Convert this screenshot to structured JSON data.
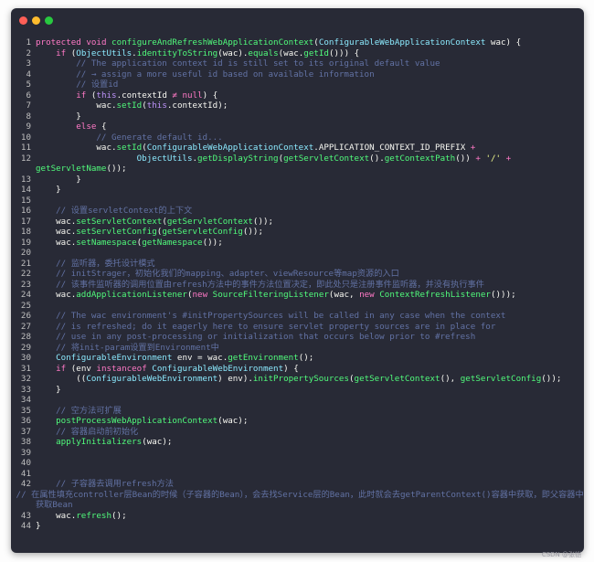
{
  "window": {
    "traffic_lights": {
      "close_color": "#ff5f57",
      "minimize_color": "#febc2e",
      "zoom_color": "#28c840"
    }
  },
  "code_lines": [
    {
      "n": "1",
      "t": [
        [
          "kw",
          "protected"
        ],
        [
          "id",
          " "
        ],
        [
          "kw",
          "void"
        ],
        [
          "id",
          " "
        ],
        [
          "fn",
          "configureAndRefreshWebApplicationContext"
        ],
        [
          "id",
          "("
        ],
        [
          "ty",
          "ConfigurableWebApplicationContext"
        ],
        [
          "id",
          " wac) {"
        ]
      ]
    },
    {
      "n": "2",
      "t": [
        [
          "id",
          "    "
        ],
        [
          "kw",
          "if"
        ],
        [
          "id",
          " ("
        ],
        [
          "ty",
          "ObjectUtils"
        ],
        [
          "id",
          "."
        ],
        [
          "fn",
          "identityToString"
        ],
        [
          "id",
          "(wac)."
        ],
        [
          "fn",
          "equals"
        ],
        [
          "id",
          "(wac."
        ],
        [
          "fn",
          "getId"
        ],
        [
          "id",
          "())) {"
        ]
      ]
    },
    {
      "n": "3",
      "t": [
        [
          "id",
          "        "
        ],
        [
          "cm",
          "// The application context id is still set to its original default value"
        ]
      ]
    },
    {
      "n": "4",
      "t": [
        [
          "id",
          "        "
        ],
        [
          "cm",
          "// → assign a more useful id based on available information"
        ]
      ]
    },
    {
      "n": "5",
      "t": [
        [
          "id",
          "        "
        ],
        [
          "cm",
          "// 设置id"
        ]
      ]
    },
    {
      "n": "6",
      "t": [
        [
          "id",
          "        "
        ],
        [
          "kw",
          "if"
        ],
        [
          "id",
          " ("
        ],
        [
          "th",
          "this"
        ],
        [
          "id",
          ".contextId "
        ],
        [
          "op",
          "≠"
        ],
        [
          "id",
          " "
        ],
        [
          "kw",
          "null"
        ],
        [
          "id",
          ") {"
        ]
      ]
    },
    {
      "n": "7",
      "t": [
        [
          "id",
          "            wac."
        ],
        [
          "fn",
          "setId"
        ],
        [
          "id",
          "("
        ],
        [
          "th",
          "this"
        ],
        [
          "id",
          ".contextId);"
        ]
      ]
    },
    {
      "n": "8",
      "t": [
        [
          "id",
          "        }"
        ]
      ]
    },
    {
      "n": "9",
      "t": [
        [
          "id",
          "        "
        ],
        [
          "kw",
          "else"
        ],
        [
          "id",
          " {"
        ]
      ]
    },
    {
      "n": "10",
      "t": [
        [
          "id",
          "            "
        ],
        [
          "cm",
          "// Generate default id..."
        ]
      ]
    },
    {
      "n": "11",
      "t": [
        [
          "id",
          "            wac."
        ],
        [
          "fn",
          "setId"
        ],
        [
          "id",
          "("
        ],
        [
          "ty",
          "ConfigurableWebApplicationContext"
        ],
        [
          "id",
          ".APPLICATION_CONTEXT_ID_PREFIX "
        ],
        [
          "op",
          "+"
        ]
      ]
    },
    {
      "n": "12",
      "t": [
        [
          "id",
          "                    "
        ],
        [
          "ty",
          "ObjectUtils"
        ],
        [
          "id",
          "."
        ],
        [
          "fn",
          "getDisplayString"
        ],
        [
          "id",
          "("
        ],
        [
          "fn",
          "getServletContext"
        ],
        [
          "id",
          "()."
        ],
        [
          "fn",
          "getContextPath"
        ],
        [
          "id",
          "()) "
        ],
        [
          "op",
          "+"
        ],
        [
          "id",
          " "
        ],
        [
          "st",
          "'/'"
        ],
        [
          "id",
          " "
        ],
        [
          "op",
          "+"
        ]
      ]
    },
    {
      "n": "",
      "t": [
        [
          "fn",
          "getServletName"
        ],
        [
          "id",
          "());"
        ]
      ]
    },
    {
      "n": "13",
      "t": [
        [
          "id",
          "        }"
        ]
      ]
    },
    {
      "n": "14",
      "t": [
        [
          "id",
          "    }"
        ]
      ]
    },
    {
      "n": "15",
      "t": [
        [
          "id",
          ""
        ]
      ]
    },
    {
      "n": "16",
      "t": [
        [
          "id",
          "    "
        ],
        [
          "cm",
          "// 设置servletContext的上下文"
        ]
      ]
    },
    {
      "n": "17",
      "t": [
        [
          "id",
          "    wac."
        ],
        [
          "fn",
          "setServletContext"
        ],
        [
          "id",
          "("
        ],
        [
          "fn",
          "getServletContext"
        ],
        [
          "id",
          "());"
        ]
      ]
    },
    {
      "n": "18",
      "t": [
        [
          "id",
          "    wac."
        ],
        [
          "fn",
          "setServletConfig"
        ],
        [
          "id",
          "("
        ],
        [
          "fn",
          "getServletConfig"
        ],
        [
          "id",
          "());"
        ]
      ]
    },
    {
      "n": "19",
      "t": [
        [
          "id",
          "    wac."
        ],
        [
          "fn",
          "setNamespace"
        ],
        [
          "id",
          "("
        ],
        [
          "fn",
          "getNamespace"
        ],
        [
          "id",
          "());"
        ]
      ]
    },
    {
      "n": "20",
      "t": [
        [
          "id",
          ""
        ]
      ]
    },
    {
      "n": "21",
      "t": [
        [
          "id",
          "    "
        ],
        [
          "cm",
          "// 监听器，委托设计模式"
        ]
      ]
    },
    {
      "n": "22",
      "t": [
        [
          "id",
          "    "
        ],
        [
          "cm",
          "// initStrager，初始化我们的mapping、adapter、viewResource等map资源的入口"
        ]
      ]
    },
    {
      "n": "23",
      "t": [
        [
          "id",
          "    "
        ],
        [
          "cm",
          "// 该事件监听器的调用位置由refresh方法中的事件方法位置决定，即此处只是注册事件监听器，并没有执行事件"
        ]
      ]
    },
    {
      "n": "24",
      "t": [
        [
          "id",
          "    wac."
        ],
        [
          "fn",
          "addApplicationListener"
        ],
        [
          "id",
          "("
        ],
        [
          "kw",
          "new"
        ],
        [
          "id",
          " "
        ],
        [
          "fn",
          "SourceFilteringListener"
        ],
        [
          "id",
          "(wac, "
        ],
        [
          "kw",
          "new"
        ],
        [
          "id",
          " "
        ],
        [
          "fn",
          "ContextRefreshListener"
        ],
        [
          "id",
          "()));"
        ]
      ]
    },
    {
      "n": "25",
      "t": [
        [
          "id",
          ""
        ]
      ]
    },
    {
      "n": "26",
      "t": [
        [
          "id",
          "    "
        ],
        [
          "cm",
          "// The wac environment's #initPropertySources will be called in any case when the context"
        ]
      ]
    },
    {
      "n": "27",
      "t": [
        [
          "id",
          "    "
        ],
        [
          "cm",
          "// is refreshed; do it eagerly here to ensure servlet property sources are in place for"
        ]
      ]
    },
    {
      "n": "28",
      "t": [
        [
          "id",
          "    "
        ],
        [
          "cm",
          "// use in any post-processing or initialization that occurs below prior to #refresh"
        ]
      ]
    },
    {
      "n": "29",
      "t": [
        [
          "id",
          "    "
        ],
        [
          "cm",
          "// 将init-param设置到Environment中"
        ]
      ]
    },
    {
      "n": "30",
      "t": [
        [
          "id",
          "    "
        ],
        [
          "ty",
          "ConfigurableEnvironment"
        ],
        [
          "id",
          " env = wac."
        ],
        [
          "fn",
          "getEnvironment"
        ],
        [
          "id",
          "();"
        ]
      ]
    },
    {
      "n": "31",
      "t": [
        [
          "id",
          "    "
        ],
        [
          "kw",
          "if"
        ],
        [
          "id",
          " (env "
        ],
        [
          "kw",
          "instanceof"
        ],
        [
          "id",
          " "
        ],
        [
          "ty",
          "ConfigurableWebEnvironment"
        ],
        [
          "id",
          ") {"
        ]
      ]
    },
    {
      "n": "32",
      "t": [
        [
          "id",
          "        (("
        ],
        [
          "ty",
          "ConfigurableWebEnvironment"
        ],
        [
          "id",
          ") env)."
        ],
        [
          "fn",
          "initPropertySources"
        ],
        [
          "id",
          "("
        ],
        [
          "fn",
          "getServletContext"
        ],
        [
          "id",
          "(), "
        ],
        [
          "fn",
          "getServletConfig"
        ],
        [
          "id",
          "());"
        ]
      ]
    },
    {
      "n": "33",
      "t": [
        [
          "id",
          "    }"
        ]
      ]
    },
    {
      "n": "34",
      "t": [
        [
          "id",
          ""
        ]
      ]
    },
    {
      "n": "35",
      "t": [
        [
          "id",
          "    "
        ],
        [
          "cm",
          "// 空方法可扩展"
        ]
      ]
    },
    {
      "n": "36",
      "t": [
        [
          "id",
          "    "
        ],
        [
          "fn",
          "postProcessWebApplicationContext"
        ],
        [
          "id",
          "(wac);"
        ]
      ]
    },
    {
      "n": "37",
      "t": [
        [
          "id",
          "    "
        ],
        [
          "cm",
          "// 容器启动前初始化"
        ]
      ]
    },
    {
      "n": "38",
      "t": [
        [
          "id",
          "    "
        ],
        [
          "fn",
          "applyInitializers"
        ],
        [
          "id",
          "(wac);"
        ]
      ]
    },
    {
      "n": "39",
      "t": [
        [
          "id",
          ""
        ]
      ]
    },
    {
      "n": "40",
      "t": [
        [
          "id",
          ""
        ]
      ]
    },
    {
      "n": "41",
      "t": [
        [
          "id",
          ""
        ]
      ]
    },
    {
      "n": "42",
      "t": [
        [
          "id",
          "    "
        ],
        [
          "cm",
          "// 子容器去调用refresh方法"
        ]
      ]
    },
    {
      "n": "",
      "cont": true,
      "t": [
        [
          "id",
          "    "
        ],
        [
          "cm",
          "// 在属性填充controller层Bean的时候（子容器的Bean），会去找Service层的Bean，此时就会去getParentContext()容器中获取，即父容器中获取Bean"
        ]
      ]
    },
    {
      "n": "43",
      "t": [
        [
          "id",
          "    wac."
        ],
        [
          "fn",
          "refresh"
        ],
        [
          "id",
          "();"
        ]
      ]
    },
    {
      "n": "44",
      "t": [
        [
          "id",
          "}"
        ]
      ]
    }
  ],
  "watermark": "CSDN @张铠"
}
